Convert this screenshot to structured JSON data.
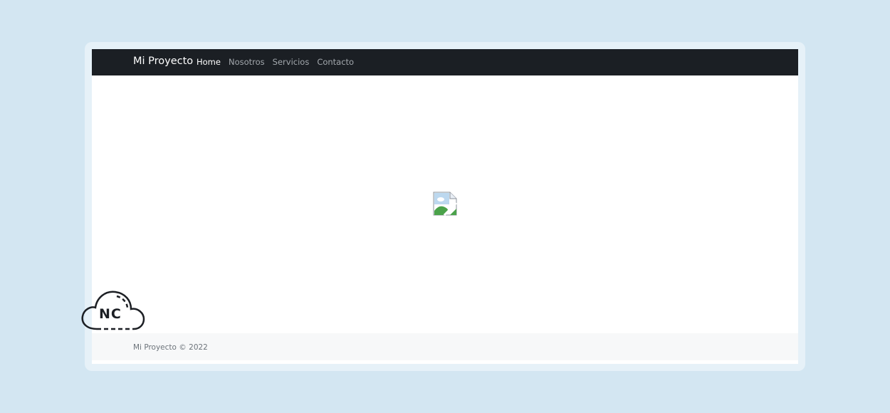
{
  "navbar": {
    "brand": "Mi Proyecto",
    "links": [
      {
        "label": "Home",
        "active": true
      },
      {
        "label": "Nosotros",
        "active": false
      },
      {
        "label": "Servicios",
        "active": false
      },
      {
        "label": "Contacto",
        "active": false
      }
    ]
  },
  "main": {
    "image_icon": "broken-image-icon"
  },
  "footer": {
    "text": "Mi Proyecto © 2022"
  },
  "overlay": {
    "logo_text": "NC",
    "logo_icon": "cloud-icon"
  },
  "colors": {
    "background": "#d3e6f2",
    "navbar": "#1b1f24",
    "footer": "#f7f8f9"
  }
}
